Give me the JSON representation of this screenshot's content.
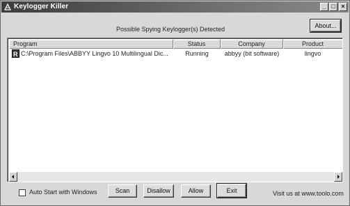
{
  "window": {
    "title": "Keylogger Killer",
    "minimize_glyph": "_",
    "maximize_glyph": "□",
    "close_glyph": "×"
  },
  "status": {
    "text": "Possible Spying Keylogger(s) Detected"
  },
  "about_button": {
    "label": "About..."
  },
  "table": {
    "columns": [
      "Program",
      "Status",
      "Company",
      "Product"
    ],
    "rows": [
      {
        "program": "C:\\Program Files\\ABBYY Lingvo 10 Multilingual Dic...",
        "status": "Running",
        "company": "abbyy (bit software)",
        "product": "lingvo",
        "icon": "app-icon"
      }
    ]
  },
  "scrollbar": {
    "left_glyph": "◂",
    "right_glyph": "▸"
  },
  "footer": {
    "auto_start_label": "Auto Start with Windows",
    "auto_start_checked": false,
    "scan_label": "Scan",
    "disallow_label": "Disallow",
    "allow_label": "Allow",
    "exit_label": "Exit",
    "visit_text": "Visit us at www.toolo.com"
  }
}
